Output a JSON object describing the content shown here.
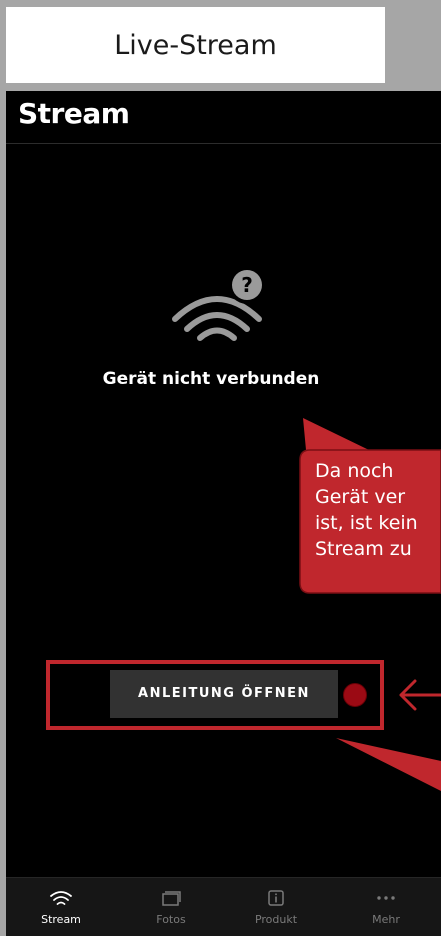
{
  "caption": {
    "title": "Live-Stream"
  },
  "header": {
    "title": "Stream"
  },
  "status": {
    "icon": "wifi-question-icon",
    "text": "Gerät nicht verbunden"
  },
  "manual_button": {
    "label": "ANLEITUNG ÖFFNEN"
  },
  "callout": {
    "lines": [
      "Da noch",
      "Gerät ver",
      "ist, ist kein",
      "Stream zu"
    ],
    "color": "#c0272d"
  },
  "annotation": {
    "arrow_icon": "arrow-left-icon",
    "color": "#c0272d"
  },
  "tabbar": {
    "tabs": [
      {
        "label": "Stream",
        "icon": "wifi-icon",
        "active": true
      },
      {
        "label": "Fotos",
        "icon": "photos-icon",
        "active": false
      },
      {
        "label": "Produkt",
        "icon": "info-icon",
        "active": false
      },
      {
        "label": "Mehr",
        "icon": "more-icon",
        "active": false
      }
    ]
  },
  "colors": {
    "background": "#000000",
    "accent": "#c0272d",
    "button": "#323232",
    "tabbar": "#161616"
  }
}
